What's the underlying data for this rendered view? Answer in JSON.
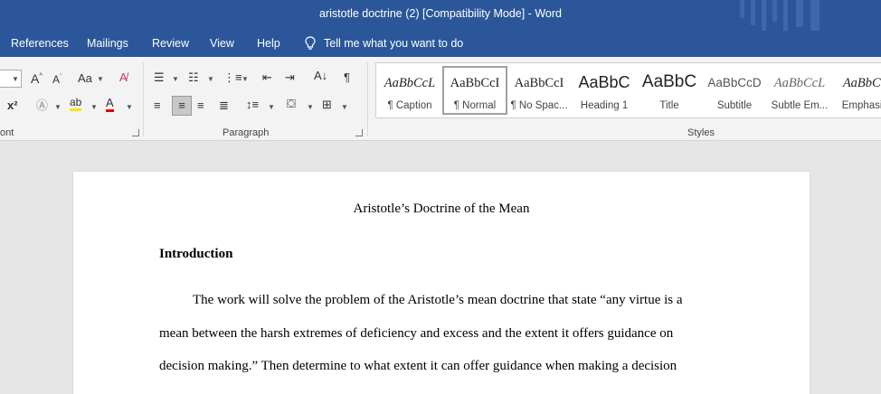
{
  "window": {
    "title": "aristotle doctrine (2) [Compatibility Mode]  -  Word"
  },
  "menu": {
    "tabs": [
      "References",
      "Mailings",
      "Review",
      "View",
      "Help"
    ],
    "tell_me": "Tell me what you want to do"
  },
  "ribbon": {
    "font_group_label": "ont",
    "paragraph_group_label": "Paragraph",
    "styles_group_label": "Styles",
    "styles": [
      {
        "preview": "AaBbCcL",
        "name": "¶ Caption"
      },
      {
        "preview": "AaBbCcI",
        "name": "¶ Normal"
      },
      {
        "preview": "AaBbCcI",
        "name": "¶ No Spac..."
      },
      {
        "preview": "AaBbC",
        "name": "Heading 1"
      },
      {
        "preview": "AaBbC",
        "name": "Title"
      },
      {
        "preview": "AaBbCcD",
        "name": "Subtitle"
      },
      {
        "preview": "AaBbCcL",
        "name": "Subtle Em..."
      },
      {
        "preview": "AaBbCc",
        "name": "Emphasis"
      }
    ]
  },
  "document": {
    "title": "Aristotle’s Doctrine of the Mean",
    "heading": "Introduction",
    "lines": [
      "The work will solve the problem of the Aristotle’s mean doctrine that state “any virtue is a",
      "mean between the harsh extremes of deficiency and excess and the extent it offers guidance on",
      "decision making.”  Then determine to what extent it can offer guidance when making a decision"
    ]
  }
}
